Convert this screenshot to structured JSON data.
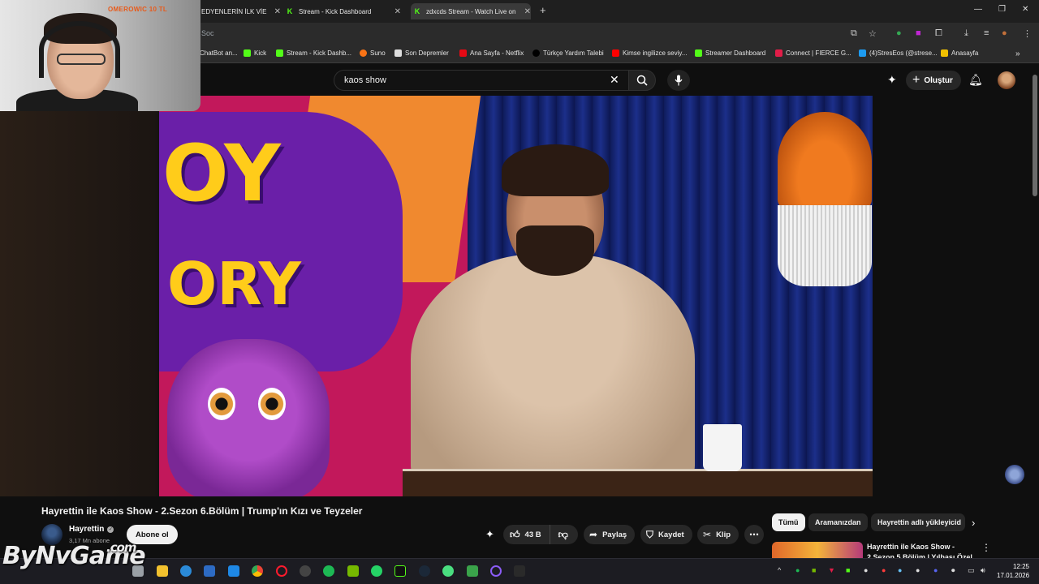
{
  "browser": {
    "tabs": [
      {
        "label": "EDYENLERİN İLK VİE",
        "icon": "generic-tab-icon"
      },
      {
        "label": "Stream - Kick Dashboard",
        "icon": "kick-icon"
      },
      {
        "label": "zdxcds Stream - Watch Live on",
        "icon": "kick-icon"
      }
    ],
    "url": "Soc",
    "bookmarks": [
      {
        "label": "ChatBot an...",
        "color": "#888888"
      },
      {
        "label": "Kick",
        "color": "#53fc18"
      },
      {
        "label": "Stream - Kick Dashb...",
        "color": "#53fc18"
      },
      {
        "label": "Suno",
        "color": "#f97316"
      },
      {
        "label": "Son Depremler",
        "color": "#dddddd"
      },
      {
        "label": "Ana Sayfa - Netflix",
        "color": "#e50914"
      },
      {
        "label": "Türkçe Yardım Talebi",
        "color": "#222222"
      },
      {
        "label": "Kimse ingilizce seviy...",
        "color": "#ff0000"
      },
      {
        "label": "Streamer Dashboard",
        "color": "#53fc18"
      },
      {
        "label": "Connect | FIERCE G...",
        "color": "#e11d48"
      },
      {
        "label": "(4)StresEos (@strese...",
        "color": "#1d9bf0"
      },
      {
        "label": "Anasayfa",
        "color": "#f0c000"
      }
    ]
  },
  "webcam": {
    "overlay_text": "OMEROWIC 10 TL"
  },
  "youtube": {
    "search_query": "kaos show",
    "create_label": "Oluştur",
    "video_title": "Hayrettin ile Kaos Show - 2.Sezon 6.Bölüm | Trump'ın Kızı ve Teyzeler",
    "channel_name": "Hayrettin",
    "subscribers": "3,17 Mn abone",
    "subscribe_label": "Abone ol",
    "likes": "43 B",
    "share_label": "Paylaş",
    "save_label": "Kaydet",
    "clip_label": "Klip",
    "chips": [
      "Tümü",
      "Aramanızdan",
      "Hayrettin adlı yükleyicid"
    ],
    "recommended_title": "Hayrettin ile Kaos Show - 2.Sezon 5.Bölüm | Yılbaşı Özel"
  },
  "taskbar": {
    "time": "12:25",
    "date": "17.01.2026"
  },
  "watermark": {
    "text": "ByNvGame",
    "suffix": ".com"
  },
  "colors": {
    "background": "#0f0f0f",
    "kick_green": "#53fc18",
    "youtube_red": "#ff0000"
  }
}
